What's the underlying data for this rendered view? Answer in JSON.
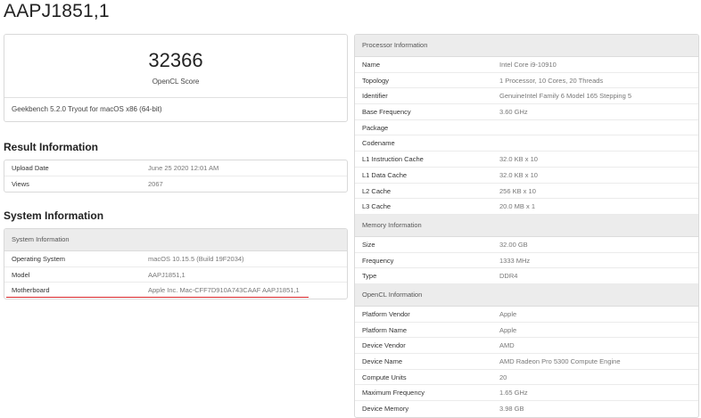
{
  "page": {
    "title": "AAPJ1851,1"
  },
  "score": {
    "value": "32366",
    "label": "OpenCL Score",
    "version": "Geekbench 5.2.0 Tryout for macOS x86 (64-bit)"
  },
  "result_information": {
    "heading": "Result Information",
    "rows": [
      {
        "key": "Upload Date",
        "value": "June 25 2020 12:01 AM"
      },
      {
        "key": "Views",
        "value": "2067"
      }
    ]
  },
  "system_information": {
    "heading": "System Information",
    "table_header": "System Information",
    "rows": [
      {
        "key": "Operating System",
        "value": "macOS 10.15.5 (Build 19F2034)"
      },
      {
        "key": "Model",
        "value": "AAPJ1851,1"
      },
      {
        "key": "Motherboard",
        "value": "Apple Inc. Mac-CFF7D910A743CAAF AAPJ1851,1"
      }
    ]
  },
  "processor_information": {
    "table_header": "Processor Information",
    "rows": [
      {
        "key": "Name",
        "value": "Intel Core i9-10910"
      },
      {
        "key": "Topology",
        "value": "1 Processor, 10 Cores, 20 Threads"
      },
      {
        "key": "Identifier",
        "value": "GenuineIntel Family 6 Model 165 Stepping 5"
      },
      {
        "key": "Base Frequency",
        "value": "3.60 GHz"
      },
      {
        "key": "Package",
        "value": ""
      },
      {
        "key": "Codename",
        "value": ""
      },
      {
        "key": "L1 Instruction Cache",
        "value": "32.0 KB x 10"
      },
      {
        "key": "L1 Data Cache",
        "value": "32.0 KB x 10"
      },
      {
        "key": "L2 Cache",
        "value": "256 KB x 10"
      },
      {
        "key": "L3 Cache",
        "value": "20.0 MB x 1"
      }
    ]
  },
  "memory_information": {
    "table_header": "Memory Information",
    "rows": [
      {
        "key": "Size",
        "value": "32.00 GB"
      },
      {
        "key": "Frequency",
        "value": "1333 MHz"
      },
      {
        "key": "Type",
        "value": "DDR4"
      }
    ]
  },
  "opencl_information": {
    "table_header": "OpenCL Information",
    "rows": [
      {
        "key": "Platform Vendor",
        "value": "Apple"
      },
      {
        "key": "Platform Name",
        "value": "Apple"
      },
      {
        "key": "Device Vendor",
        "value": "AMD"
      },
      {
        "key": "Device Name",
        "value": "AMD Radeon Pro 5300 Compute Engine"
      },
      {
        "key": "Compute Units",
        "value": "20"
      },
      {
        "key": "Maximum Frequency",
        "value": "1.65 GHz"
      },
      {
        "key": "Device Memory",
        "value": "3.98 GB"
      }
    ]
  },
  "colors": {
    "highlight_underline": "#d9262b",
    "header_background": "#ececec",
    "border": "#d9d9d9"
  }
}
